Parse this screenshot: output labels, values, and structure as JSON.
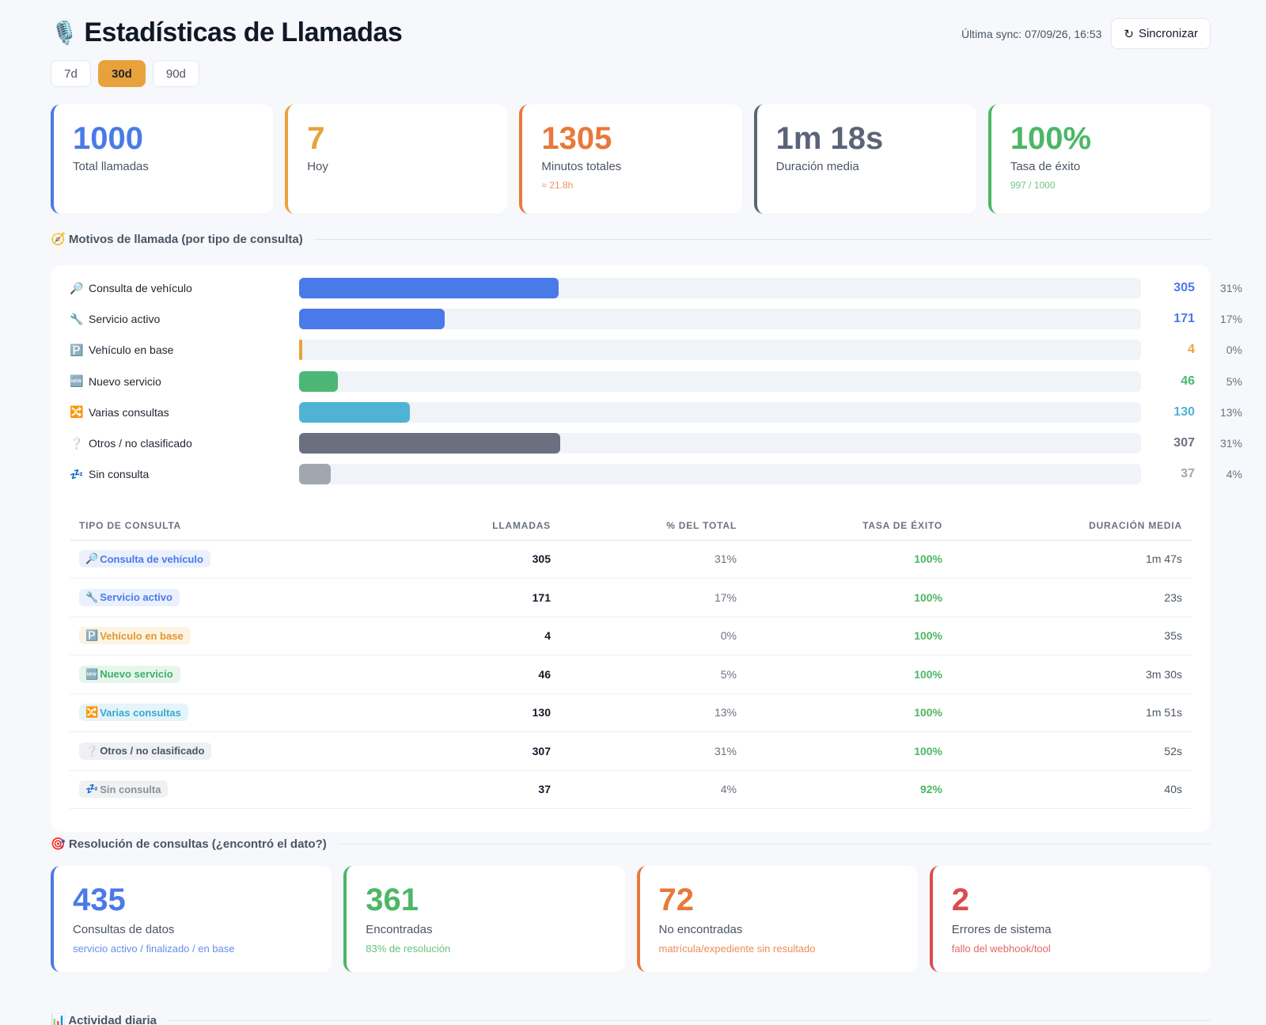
{
  "header": {
    "title": "Estadísticas de Llamadas",
    "title_icon": "🎙️",
    "sync_text": "Última sync: 07/09/26, 16:53",
    "sync_button": "Sincronizar",
    "sync_icon": "↻",
    "range_tabs": [
      {
        "label": "7d",
        "active": false
      },
      {
        "label": "30d",
        "active": true
      },
      {
        "label": "90d",
        "active": false
      }
    ]
  },
  "kpis": [
    {
      "value": "1000",
      "label": "Total llamadas",
      "sub": "",
      "color": "#4a7ae8"
    },
    {
      "value": "7",
      "label": "Hoy",
      "sub": "",
      "color": "#e9a23b"
    },
    {
      "value": "1305",
      "label": "Minutos totales",
      "sub": "≈ 21.8h",
      "color": "#e8793a"
    },
    {
      "value": "1m 18s",
      "label": "Duración media",
      "sub": "",
      "color": "#5b6477"
    },
    {
      "value": "100%",
      "label": "Tasa de éxito",
      "sub": "997 / 1000",
      "color": "#4cb765"
    }
  ],
  "motivos": {
    "heading": "Motivos de llamada (por tipo de consulta)",
    "heading_icon": "🧭",
    "bar_max": 990,
    "bars": [
      {
        "icon": "🔎",
        "label": "Consulta de vehículo",
        "count": "305",
        "value": 305,
        "pct": "31%",
        "color": "#4a7ae8"
      },
      {
        "icon": "🔧",
        "label": "Servicio activo",
        "count": "171",
        "value": 171,
        "pct": "17%",
        "color": "#4a7ae8"
      },
      {
        "icon": "🅿️",
        "label": "Vehículo en base",
        "count": "4",
        "value": 4,
        "pct": "0%",
        "color": "#e9a23b"
      },
      {
        "icon": "🆕",
        "label": "Nuevo servicio",
        "count": "46",
        "value": 46,
        "pct": "5%",
        "color": "#4cb774"
      },
      {
        "icon": "🔀",
        "label": "Varias consultas",
        "count": "130",
        "value": 130,
        "pct": "13%",
        "color": "#4fb3d5"
      },
      {
        "icon": "❔",
        "label": "Otros / no clasificado",
        "count": "307",
        "value": 307,
        "pct": "31%",
        "color": "#6b7080"
      },
      {
        "icon": "💤",
        "label": "Sin consulta",
        "count": "37",
        "value": 37,
        "pct": "4%",
        "color": "#a2a6ae"
      }
    ],
    "table": {
      "headers": [
        "Tipo de consulta",
        "Llamadas",
        "% del total",
        "Tasa de éxito",
        "Duración media"
      ],
      "rows": [
        {
          "icon": "🔎",
          "type": "Consulta de vehículo",
          "calls": "305",
          "pct": "31%",
          "success": "100%",
          "duration": "1m 47s",
          "color": "#4a7ae8",
          "bg": "#eaf0fc"
        },
        {
          "icon": "🔧",
          "type": "Servicio activo",
          "calls": "171",
          "pct": "17%",
          "success": "100%",
          "duration": "23s",
          "color": "#4a7ae8",
          "bg": "#eaf0fc"
        },
        {
          "icon": "🅿️",
          "type": "Vehículo en base",
          "calls": "4",
          "pct": "0%",
          "success": "100%",
          "duration": "35s",
          "color": "#e09a2e",
          "bg": "#fdf3e2"
        },
        {
          "icon": "🆕",
          "type": "Nuevo servicio",
          "calls": "46",
          "pct": "5%",
          "success": "100%",
          "duration": "3m 30s",
          "color": "#3fae6a",
          "bg": "#e6f6ec"
        },
        {
          "icon": "🔀",
          "type": "Varias consultas",
          "calls": "130",
          "pct": "13%",
          "success": "100%",
          "duration": "1m 51s",
          "color": "#3aa8cf",
          "bg": "#e5f4fa"
        },
        {
          "icon": "❔",
          "type": "Otros / no clasificado",
          "calls": "307",
          "pct": "31%",
          "success": "100%",
          "duration": "52s",
          "color": "#4b5563",
          "bg": "#eef0f3"
        },
        {
          "icon": "💤",
          "type": "Sin consulta",
          "calls": "37",
          "pct": "4%",
          "success": "92%",
          "duration": "40s",
          "color": "#8a8f99",
          "bg": "#f0f1f3"
        }
      ]
    },
    "success_color": "#4cb765"
  },
  "resolucion": {
    "heading": "Resolución de consultas (¿encontró el dato?)",
    "heading_icon": "🎯",
    "cards": [
      {
        "value": "435",
        "label": "Consultas de datos",
        "sub": "servicio activo / finalizado / en base",
        "color": "#4a7ae8"
      },
      {
        "value": "361",
        "label": "Encontradas",
        "sub": "83% de resolución",
        "color": "#4cb765"
      },
      {
        "value": "72",
        "label": "No encontradas",
        "sub": "matrícula/expediente sin resultado",
        "color": "#e8793a"
      },
      {
        "value": "2",
        "label": "Errores de sistema",
        "sub": "fallo del webhook/tool",
        "color": "#dc4b4b"
      }
    ]
  },
  "actividad": {
    "heading": "Actividad diaria",
    "heading_icon": "📊"
  }
}
